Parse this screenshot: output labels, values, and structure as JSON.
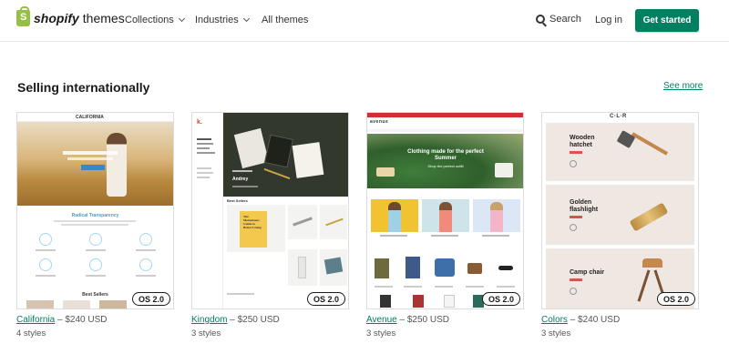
{
  "header": {
    "brand": "shopify",
    "brand_suffix": "themes",
    "nav": [
      {
        "label": "Collections",
        "has_dropdown": true
      },
      {
        "label": "Industries",
        "has_dropdown": true
      },
      {
        "label": "All themes",
        "has_dropdown": false
      }
    ],
    "search_label": "Search",
    "login_label": "Log in",
    "cta_label": "Get started",
    "accent_color": "#008060"
  },
  "section": {
    "title": "Selling internationally",
    "see_more": "See more"
  },
  "themes": [
    {
      "name": "California",
      "price": " – $240 USD",
      "styles": "4 styles",
      "badge": "OS 2.0"
    },
    {
      "name": "Kingdom",
      "price": " – $250 USD",
      "styles": "3 styles",
      "badge": "OS 2.0"
    },
    {
      "name": "Avenue",
      "price": " – $250 USD",
      "styles": "3 styles",
      "badge": "OS 2.0"
    },
    {
      "name": "Colors",
      "price": " – $240 USD",
      "styles": "3 styles",
      "badge": "OS 2.0"
    }
  ],
  "previews": {
    "california": {
      "logo": "CALIFORNIA",
      "section_heading": "Radical Transparency",
      "bestsellers": "Best Sellers"
    },
    "kingdom": {
      "logo": "k.",
      "product": "Andrey",
      "list_heading": "Best Sellers",
      "book_title": "The Momentous Guide to Better Living"
    },
    "avenue": {
      "logo": "avenue",
      "hero_text": "Clothing made for the perfect Summer",
      "hero_sub": "Shop the perfect outfit"
    },
    "colors": {
      "logo": "C·L·R",
      "products": [
        "Wooden hatchet",
        "Golden flashlight",
        "Camp chair"
      ]
    }
  }
}
